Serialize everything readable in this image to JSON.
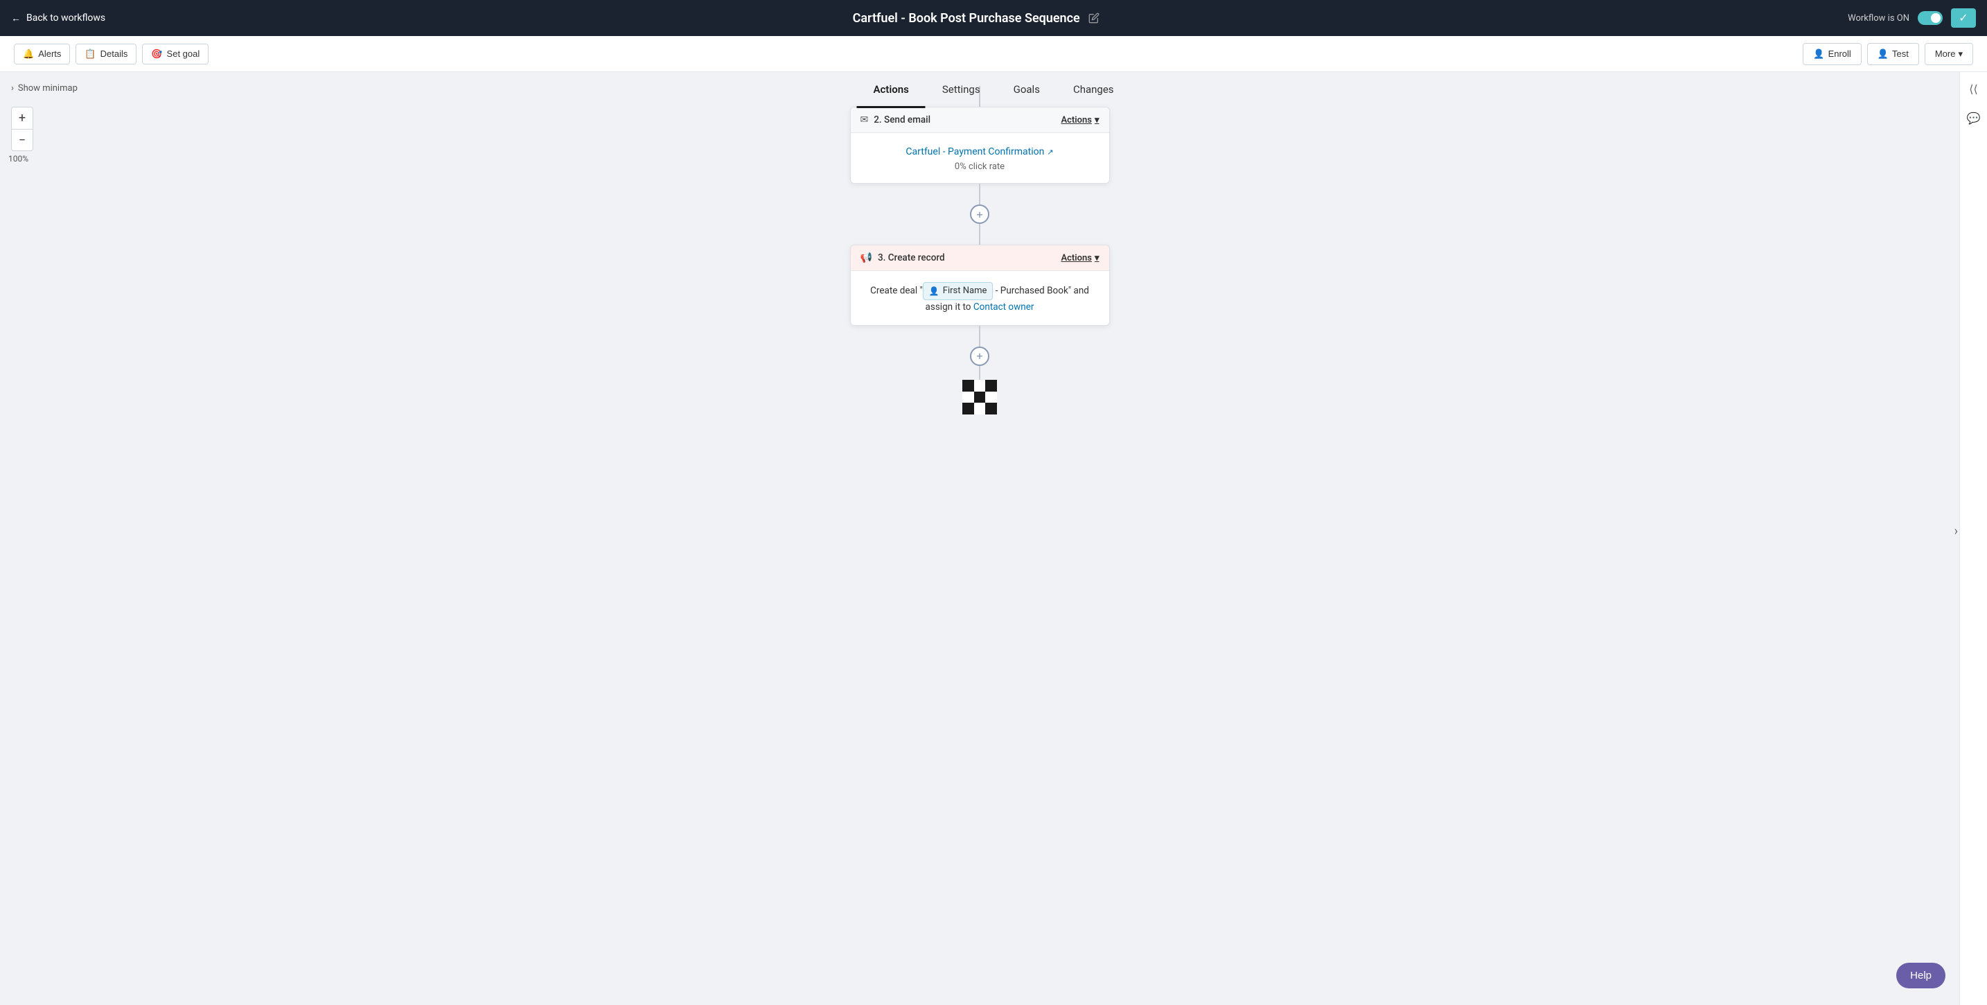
{
  "topbar": {
    "back_label": "Back to workflows",
    "title": "Cartfuel - Book Post Purchase Sequence",
    "workflow_status": "Workflow is ON",
    "check_icon": "✓"
  },
  "toolbar": {
    "alerts_label": "Alerts",
    "details_label": "Details",
    "set_goal_label": "Set goal",
    "enroll_label": "Enroll",
    "test_label": "Test",
    "more_label": "More"
  },
  "tabs": [
    {
      "id": "actions",
      "label": "Actions",
      "active": true
    },
    {
      "id": "settings",
      "label": "Settings",
      "active": false
    },
    {
      "id": "goals",
      "label": "Goals",
      "active": false
    },
    {
      "id": "changes",
      "label": "Changes",
      "active": false
    }
  ],
  "canvas": {
    "minimap_label": "Show minimap",
    "zoom_plus": "+",
    "zoom_minus": "−",
    "zoom_level": "100%"
  },
  "nodes": [
    {
      "id": "send-email",
      "type": "send_email",
      "step": "2",
      "header": "Send email",
      "email_name": "Cartfuel - Payment Confirmation",
      "click_rate": "0% click rate",
      "actions_label": "Actions"
    },
    {
      "id": "create-record",
      "type": "create_record",
      "step": "3",
      "header": "Create record",
      "body_prefix": "Create deal \"",
      "token_label": "First Name",
      "body_suffix": " - Purchased Book\" and assign it to",
      "contact_owner": "Contact owner",
      "actions_label": "Actions"
    }
  ],
  "help_btn_label": "Help"
}
